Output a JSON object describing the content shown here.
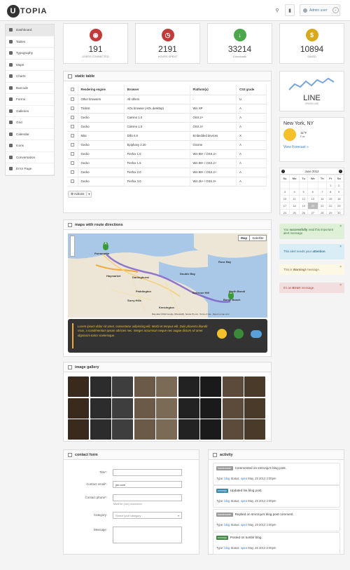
{
  "header": {
    "logo_letter": "U",
    "logo_text": "TOPIA",
    "user_label": "Admin user"
  },
  "sidebar": {
    "items": [
      {
        "label": "Dashboard"
      },
      {
        "label": "Tables"
      },
      {
        "label": "Typography"
      },
      {
        "label": "Maps"
      },
      {
        "label": "Charts"
      },
      {
        "label": "Barcode"
      },
      {
        "label": "Forms"
      },
      {
        "label": "Galleries"
      },
      {
        "label": "Grid"
      },
      {
        "label": "Calendar"
      },
      {
        "label": "Icons"
      },
      {
        "label": "Conversation"
      },
      {
        "label": "Error Page"
      }
    ]
  },
  "stats": [
    {
      "value": "191",
      "label": "USERS CONNECTED",
      "color": "#c23a3a",
      "icon": "broadcast-icon"
    },
    {
      "value": "2191",
      "label": "HOURS SPENT",
      "color": "#c23a3a",
      "icon": "clock-icon"
    },
    {
      "value": "33214",
      "label": "Downloads",
      "color": "#4aa84a",
      "icon": "download-icon"
    },
    {
      "value": "10894",
      "label": "SAVED",
      "color": "#d8a91a",
      "icon": "dollar-icon"
    }
  ],
  "static_table": {
    "title": "static table",
    "columns": [
      "Rendering engine",
      "Browser",
      "Platform(s)",
      "CSS grade"
    ],
    "rows": [
      [
        "Other browsers",
        "All others",
        "-",
        "U"
      ],
      [
        "Trident",
        "AOL browser (AOL desktop)",
        "Win XP",
        "A"
      ],
      [
        "Gecko",
        "Camino 1.0",
        "OSX.2+",
        "A"
      ],
      [
        "Gecko",
        "Camino 1.5",
        "OSX.3+",
        "A"
      ],
      [
        "Misc",
        "Dillo 0.8",
        "Embedded devices",
        "X"
      ],
      [
        "Gecko",
        "Epiphany 2.20",
        "Gnome",
        "A"
      ],
      [
        "Gecko",
        "Firefox 1.0",
        "Win 98+ / OSX.2+",
        "A"
      ],
      [
        "Gecko",
        "Firefox 1.5",
        "Win 98+ / OSX.2+",
        "A"
      ],
      [
        "Gecko",
        "Firefox 2.0",
        "Win 98+ / OSX.2+",
        "A"
      ],
      [
        "Gecko",
        "Firefox 3.0",
        "Win 2k+ / OSX.3+",
        "A"
      ]
    ],
    "actions_label": "Actions"
  },
  "sparkline": {
    "title": "LINE",
    "subtitle": "SPARKLINE"
  },
  "weather": {
    "city": "New York, NY",
    "temp": "11°F",
    "cond": "Fair",
    "link": "View Forecast »"
  },
  "calendar": {
    "month": "June 2012",
    "days": [
      "Su",
      "Mo",
      "Tu",
      "We",
      "Th",
      "Fr",
      "Sa"
    ],
    "weeks": [
      [
        "",
        "",
        "",
        "",
        "",
        "1",
        "2"
      ],
      [
        "3",
        "4",
        "5",
        "6",
        "7",
        "8",
        "9"
      ],
      [
        "10",
        "11",
        "12",
        "13",
        "14",
        "15",
        "16"
      ],
      [
        "17",
        "18",
        "19",
        "20",
        "21",
        "22",
        "23"
      ],
      [
        "24",
        "25",
        "26",
        "27",
        "28",
        "29",
        "30"
      ]
    ],
    "today": "20"
  },
  "alerts": [
    {
      "pre": "You ",
      "bold": "successfully",
      "post": " read this important alert message.",
      "bg": "#dff0d8",
      "fg": "#3c763d"
    },
    {
      "pre": "This alert needs your ",
      "bold": "attention",
      "post": ".",
      "bg": "#d9edf7",
      "fg": "#31708f"
    },
    {
      "pre": "This is ",
      "bold": "Warning!",
      "post": " message.",
      "bg": "#fcf8e3",
      "fg": "#8a6d3b"
    },
    {
      "pre": "It's an ",
      "bold": "Error!",
      "post": " message.",
      "bg": "#f2dede",
      "fg": "#a94442"
    }
  ],
  "map": {
    "title": "maps with route directions",
    "map_btn": "Map",
    "sat_btn": "Satellite",
    "labels": [
      "Parramatta",
      "Haymarket",
      "Darlinghurst",
      "Paddington",
      "Bondi Beach",
      "North Bondi",
      "Rose Bay",
      "Double Bay",
      "Surry Hills",
      "Kensington",
      "Bellevue Hill"
    ],
    "copyright": "Map data ©2012 Google, Whereis(R), Sensis Pty Ltd · Terms of Use · Report a map error",
    "info_text": "Lorem ipsum dolor sit amet, consectetur adipiscing elit. Morbi et tempus elit. Duis pharetra blandit risus, a condimentum ipsum ultricies nec. Integer accumsan neque nec augue dictum sit amet dignissim tortor scelerisque."
  },
  "gallery": {
    "title": "image gallery"
  },
  "contact": {
    "title": "contact form",
    "fields": [
      {
        "label": "Title*:",
        "value": "",
        "placeholder": ""
      },
      {
        "label": "Contact email*:",
        "value": "jon.com",
        "placeholder": ""
      },
      {
        "label": "Contact phone*:",
        "value": "",
        "placeholder": ""
      }
    ],
    "phone_hint": "Must be (xxx) xxxxxxxxx",
    "category_label": "Category:",
    "category_value": "Select your category",
    "message_label": "Message:"
  },
  "activity": {
    "title": "activity",
    "items": [
      {
        "badge": "basicheader",
        "badge_color": "#999",
        "text": "Commented on smronju's blog post.",
        "type": "blog",
        "status": "open",
        "date": "May, 25 2012 2:00pm"
      },
      {
        "badge": "smronju",
        "badge_color": "#3a87ad",
        "text": "Updated his blog post.",
        "type": "blog",
        "status": "open",
        "date": "May, 25 2012 2:00pm"
      },
      {
        "badge": "basicheader",
        "badge_color": "#999",
        "text": "Replied on smronju's blog post comment.",
        "type": "blog",
        "status": "open",
        "date": "May, 25 2012 2:00pm"
      },
      {
        "badge": "smronju",
        "badge_color": "#468847",
        "text": "Posted on tumblr blog.",
        "type": "blog",
        "status": "open",
        "date": "May, 25 2012 2:00pm"
      }
    ],
    "type_label": "Type:",
    "status_label": "Status:"
  }
}
